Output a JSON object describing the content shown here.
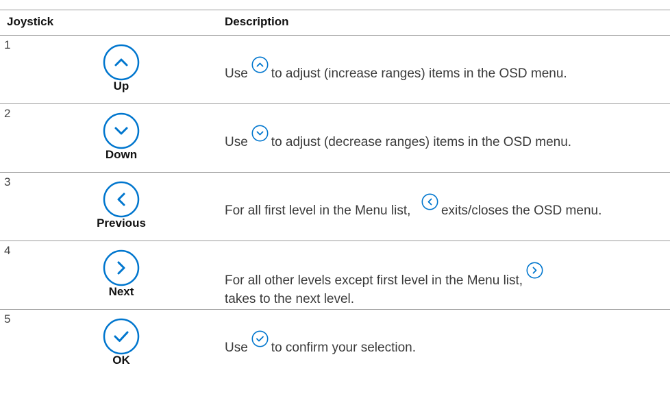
{
  "header": {
    "joystick_label": "Joystick",
    "description_label": "Description"
  },
  "rows": [
    {
      "number": "1",
      "button_label": "Up",
      "icon": "chevron-up-circle-icon",
      "desc_before": "Use",
      "desc_after": "to adjust (increase ranges) items in the OSD menu."
    },
    {
      "number": "2",
      "button_label": "Down",
      "icon": "chevron-down-circle-icon",
      "desc_before": "Use",
      "desc_after": "to adjust (decrease ranges) items in the OSD menu."
    },
    {
      "number": "3",
      "button_label": "Previous",
      "icon": "chevron-left-circle-icon",
      "desc_before": "For all first level in the Menu list,",
      "desc_after": "exits/closes the OSD menu."
    },
    {
      "number": "4",
      "button_label": "Next",
      "icon": "chevron-right-circle-icon",
      "desc_before": "For all other levels except first level in the Menu list,",
      "desc_after": "takes to the next level."
    },
    {
      "number": "5",
      "button_label": "OK",
      "icon": "checkmark-circle-icon",
      "desc_before": "Use",
      "desc_after": "to confirm your selection."
    }
  ],
  "colors": {
    "icon_blue": "#0076ce",
    "rule_gray": "#9a9a9a",
    "text": "#3a3a3a",
    "heading_text": "#111111"
  }
}
